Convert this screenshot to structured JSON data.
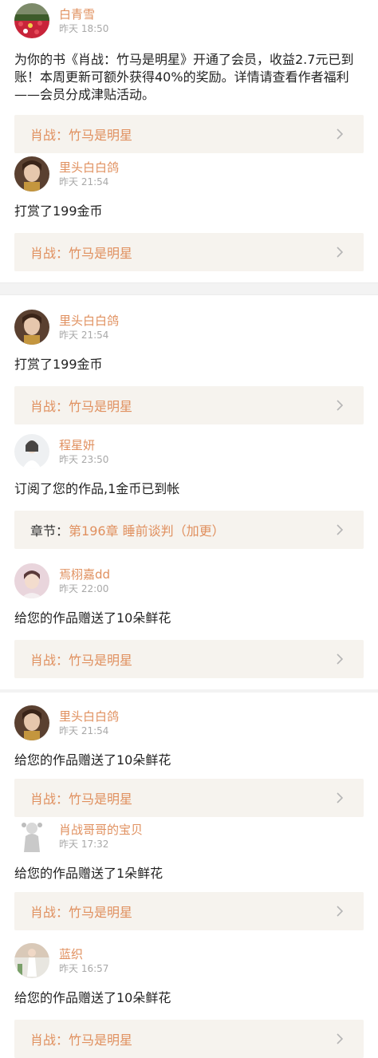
{
  "feed": [
    {
      "user": {
        "name": "白青雪",
        "time": "昨天 18:50",
        "avatar_icon": "tulip-field-avatar-icon"
      },
      "message": "为你的书《肖战：竹马是明星》开通了会员，收益2.7元已到账！本周更新可额外获得40%的奖励。详情请查看作者福利——会员分成津贴活动。",
      "link": {
        "prefix": "",
        "title": "肖战：竹马是明星"
      }
    },
    {
      "user": {
        "name": "里头白白鸽",
        "time": "昨天 21:54",
        "avatar_icon": "woman-portrait-avatar-icon"
      },
      "message": "打赏了199金币",
      "link": {
        "prefix": "",
        "title": "肖战：竹马是明星"
      }
    },
    {
      "user": {
        "name": "里头白白鸽",
        "time": "昨天 21:54",
        "avatar_icon": "woman-portrait-avatar-icon"
      },
      "message": "打赏了199金币",
      "link": {
        "prefix": "",
        "title": "肖战：竹马是明星"
      }
    },
    {
      "user": {
        "name": "程星妍",
        "time": "昨天 23:50",
        "avatar_icon": "white-dress-avatar-icon"
      },
      "message": "订阅了您的作品,1金币已到帐",
      "link": {
        "prefix": "章节：",
        "title": "第196章 睡前谈判（加更）"
      }
    },
    {
      "user": {
        "name": "焉栩嘉dd",
        "time": "昨天 22:00",
        "avatar_icon": "pink-portrait-avatar-icon"
      },
      "message": "给您的作品赠送了10朵鲜花",
      "link": {
        "prefix": "",
        "title": "肖战：竹马是明星"
      }
    },
    {
      "user": {
        "name": "里头白白鸽",
        "time": "昨天 21:54",
        "avatar_icon": "woman-portrait-avatar-icon"
      },
      "message": "给您的作品赠送了10朵鲜花",
      "link": {
        "prefix": "",
        "title": "肖战：竹马是明星"
      }
    },
    {
      "user": {
        "name": "肖战哥哥的宝贝",
        "time": "昨天 17:32",
        "avatar_icon": "sketch-figure-avatar-icon"
      },
      "message": "给您的作品赠送了1朵鲜花",
      "link": {
        "prefix": "",
        "title": "肖战：竹马是明星"
      }
    },
    {
      "user": {
        "name": "蓝织",
        "time": "昨天 16:57",
        "avatar_icon": "standing-figure-avatar-icon"
      },
      "message": "给您的作品赠送了10朵鲜花",
      "link": {
        "prefix": "",
        "title": "肖战：竹马是明星"
      }
    }
  ],
  "colors": {
    "accent": "#e0905f",
    "card_bg": "#f6f3ee",
    "time": "#a8a8a8",
    "separator": "#f3f3f3"
  }
}
